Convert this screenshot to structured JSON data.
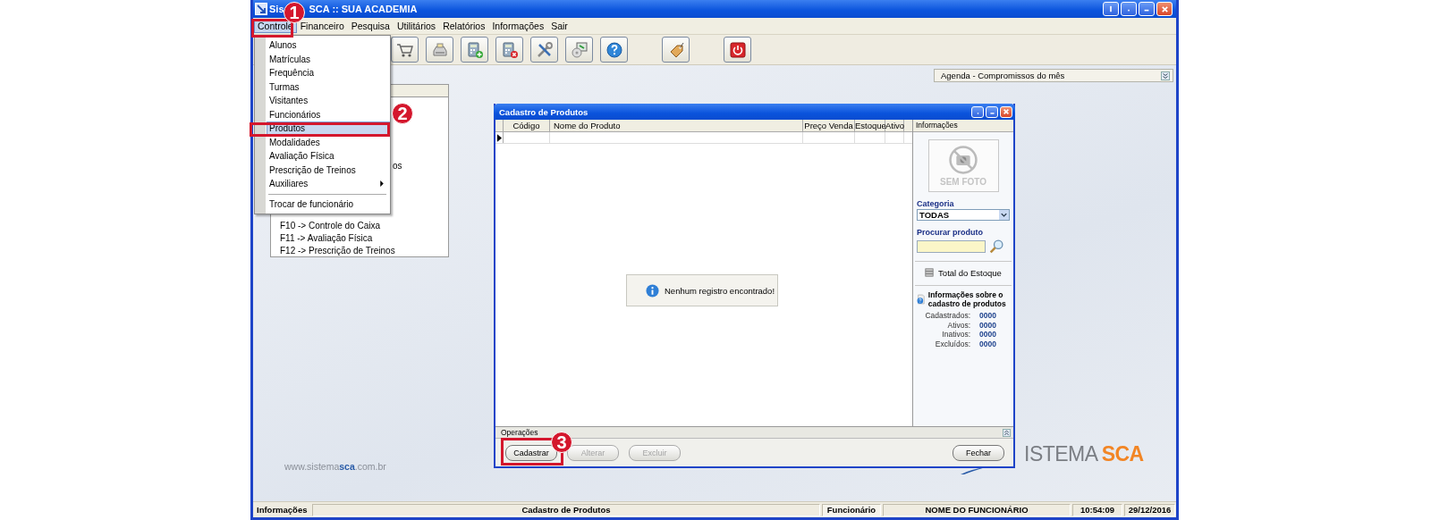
{
  "window": {
    "title_parts": [
      "Sis",
      "SCA :: SUA ACADEMIA"
    ]
  },
  "menu_bar": [
    {
      "label": "Controle",
      "selected": true
    },
    {
      "label": "Financeiro",
      "selected": false
    },
    {
      "label": "Pesquisa",
      "selected": false
    },
    {
      "label": "Utilitários",
      "selected": false
    },
    {
      "label": "Relatórios",
      "selected": false
    },
    {
      "label": "Informações",
      "selected": false
    },
    {
      "label": "Sair",
      "selected": false
    }
  ],
  "controle_menu": {
    "items": [
      {
        "kind": "item",
        "label": "Alunos",
        "selected": false
      },
      {
        "kind": "item",
        "label": "Matrículas",
        "selected": false
      },
      {
        "kind": "item",
        "label": "Frequência",
        "selected": false
      },
      {
        "kind": "item",
        "label": "Turmas",
        "selected": false
      },
      {
        "kind": "item",
        "label": "Visitantes",
        "selected": false
      },
      {
        "kind": "item",
        "label": "Funcionários",
        "selected": false
      },
      {
        "kind": "item",
        "label": "Produtos",
        "selected": true
      },
      {
        "kind": "item",
        "label": "Modalidades",
        "selected": false
      },
      {
        "kind": "item",
        "label": "Avaliação Física",
        "selected": false
      },
      {
        "kind": "item",
        "label": "Prescrição de Treinos",
        "selected": false
      },
      {
        "kind": "submenu",
        "label": "Auxiliares",
        "selected": false
      },
      {
        "kind": "separator"
      },
      {
        "kind": "item",
        "label": "Trocar de funcionário",
        "selected": false
      }
    ]
  },
  "agenda": {
    "title": "Agenda - Compromissos do mês"
  },
  "shortcuts_panel": {
    "lines": [
      {
        "kind": "partial",
        "text": "os"
      },
      {
        "kind": "line",
        "text": "F10 -> Controle do Caixa"
      },
      {
        "kind": "line",
        "text": "F11 -> Avaliação Física"
      },
      {
        "kind": "line",
        "text": "F12 -> Prescrição de Treinos"
      }
    ]
  },
  "website": "www.sistema**sca**.com.br",
  "logo": {
    "parts": [
      "ISTEMA",
      "SCA"
    ]
  },
  "product_window": {
    "title": "Cadastro de Produtos",
    "columns": [
      "Código",
      "Nome do Produto",
      "Preço Venda",
      "Estoque",
      "Ativo"
    ],
    "message": "Nenhum registro encontrado!",
    "info_panel": {
      "title": "Informações",
      "photo_text": "SEM FOTO",
      "category_label": "Categoria",
      "category_value": "TODAS",
      "search_label": "Procurar produto",
      "stock_link": "Total do Estoque",
      "info_title": "Informações sobre o cadastro de produtos",
      "stats": [
        {
          "label": "Cadastrados:",
          "value": "0000"
        },
        {
          "label": "Ativos:",
          "value": "0000"
        },
        {
          "label": "Inativos:",
          "value": "0000"
        },
        {
          "label": "Excluídos:",
          "value": "0000"
        }
      ]
    },
    "operations": {
      "title": "Operações",
      "buttons": [
        {
          "label": "Cadastrar",
          "disabled": false
        },
        {
          "label": "Alterar",
          "disabled": true
        },
        {
          "label": "Excluir",
          "disabled": true
        },
        {
          "label": "Fechar",
          "disabled": false
        }
      ]
    }
  },
  "status_bar": {
    "label": "Informações",
    "screen": "Cadastro de Produtos",
    "user_label": "Funcionário",
    "user": "NOME DO FUNCIONÁRIO",
    "time": "10:54:09",
    "date": "29/12/2016"
  },
  "annotations": [
    {
      "number": "1"
    },
    {
      "number": "2"
    },
    {
      "number": "3"
    }
  ]
}
